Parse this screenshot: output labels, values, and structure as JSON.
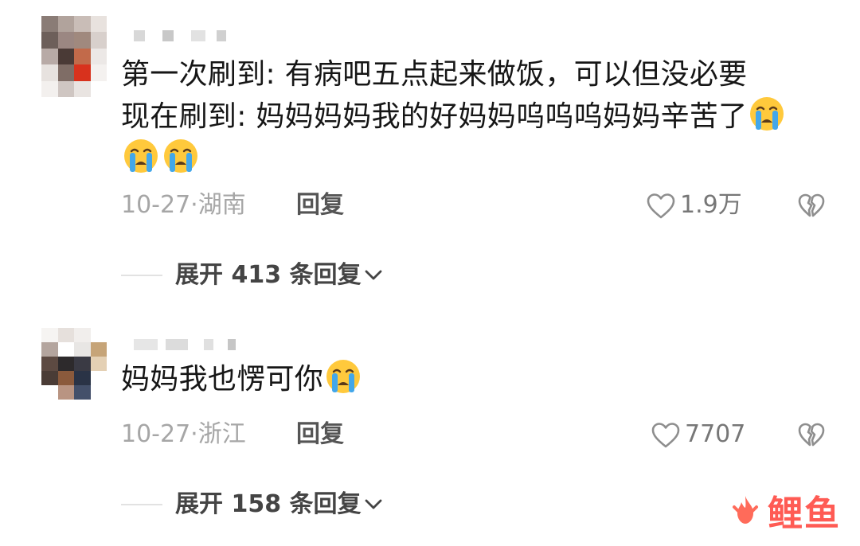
{
  "comments": [
    {
      "lines": [
        "第一次刷到: 有病吧五点起来做饭，可以但没必要",
        "现在刷到: 妈妈妈妈我的好妈妈呜呜呜妈妈辛苦了"
      ],
      "date": "10-27·湖南",
      "reply_label": "回复",
      "like_count": "1.9万",
      "expand_label": "展开 413 条回复"
    },
    {
      "lines": [
        "妈妈我也愣可你"
      ],
      "date": "10-27·浙江",
      "reply_label": "回复",
      "like_count": "7707",
      "expand_label": "展开 158 条回复"
    }
  ],
  "icons": {
    "emoji": "loudly-crying-face-icon",
    "like": "heart-outline-icon",
    "dislike": "broken-heart-icon",
    "expand": "chevron-down-icon"
  },
  "colors": {
    "text": "#161616",
    "meta": "#a6a6a6",
    "emoji_face": "#ffc93c",
    "emoji_tears": "#43a7ea",
    "watermark": "#ff5b54"
  },
  "watermark": "鲤鱼"
}
